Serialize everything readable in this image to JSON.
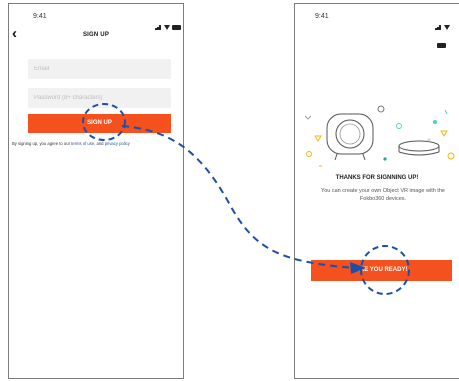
{
  "colors": {
    "accent": "#f4511e",
    "annotation": "#1e4fa8",
    "link": "#2a4f9e"
  },
  "signup_screen": {
    "status_time": "9:41",
    "back_icon": "chevron-left-icon",
    "title": "SIGN UP",
    "email_placeholder": "Email",
    "password_placeholder": "Password (8+ characters)",
    "signup_button": "SIGN UP",
    "terms_prefix": "By signing up, you agree to our",
    "terms_link": "terms of use",
    "terms_mid": ", and",
    "privacy_link": "privacy policy"
  },
  "success_screen": {
    "status_time": "9:41",
    "heading": "THANKS FOR SIGNNING UP!",
    "body": "You can create your own Object VR image with the Fokbo360 devices.",
    "ready_button": "ARE YOU READY!"
  }
}
